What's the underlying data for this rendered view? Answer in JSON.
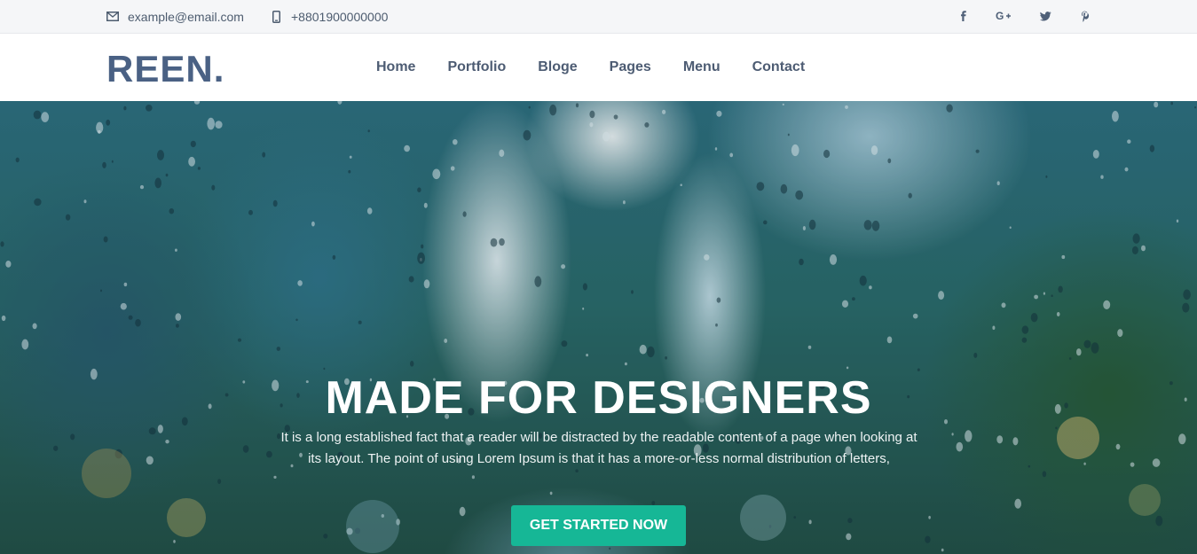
{
  "topbar": {
    "email": "example@email.com",
    "phone": "+8801900000000",
    "email_icon": "envelope-icon",
    "phone_icon": "mobile-phone-icon",
    "social": [
      "facebook-icon",
      "google-plus-icon",
      "twitter-icon",
      "pinterest-icon"
    ]
  },
  "header": {
    "logo": "REEN.",
    "nav": [
      "Home",
      "Portfolio",
      "Bloge",
      "Pages",
      "Menu",
      "Contact"
    ]
  },
  "hero": {
    "title": "MADE FOR DESIGNERS",
    "text": "It is a long established fact that a reader will be distracted by the readable content of a page when looking at its layout. The point of using Lorem Ipsum is that it has a more-or-less normal distribution of letters,",
    "cta": "GET STARTED NOW"
  },
  "colors": {
    "brand": "#4a6184",
    "accent": "#16b796",
    "nav_text": "#4d5c73",
    "topbar_bg": "#f5f6f8"
  }
}
